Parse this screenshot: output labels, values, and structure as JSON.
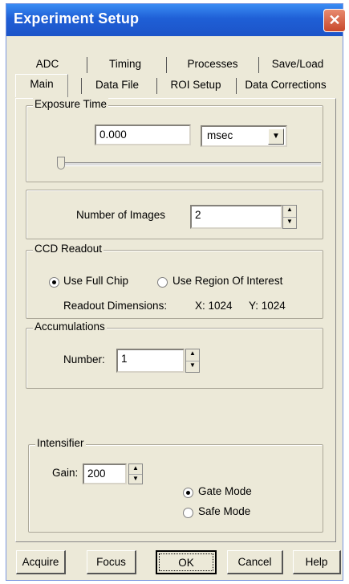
{
  "window": {
    "title": "Experiment Setup",
    "close_symbol": "✕"
  },
  "tabs": {
    "row1": [
      "ADC",
      "Timing",
      "Processes",
      "Save/Load"
    ],
    "row2": [
      "Main",
      "Data File",
      "ROI Setup",
      "Data Corrections"
    ]
  },
  "exposure": {
    "legend": "Exposure Time",
    "value": "0.000",
    "unit": "msec",
    "slider_fraction": 0
  },
  "images": {
    "label": "Number of Images",
    "value": "2"
  },
  "ccd": {
    "legend": "CCD Readout",
    "opt_full": "Use Full Chip",
    "opt_roi": "Use Region Of Interest",
    "dims_label": "Readout Dimensions:",
    "dims_x": "X: 1024",
    "dims_y": "Y: 1024"
  },
  "accum": {
    "legend": "Accumulations",
    "number_label": "Number:",
    "value": "1"
  },
  "intensifier": {
    "legend": "Intensifier",
    "gain_label": "Gain:",
    "gain_value": "200",
    "gate_mode": "Gate Mode",
    "safe_mode": "Safe Mode"
  },
  "buttons": {
    "acquire": "Acquire",
    "focus": "Focus",
    "ok": "OK",
    "cancel": "Cancel",
    "help": "Help"
  }
}
